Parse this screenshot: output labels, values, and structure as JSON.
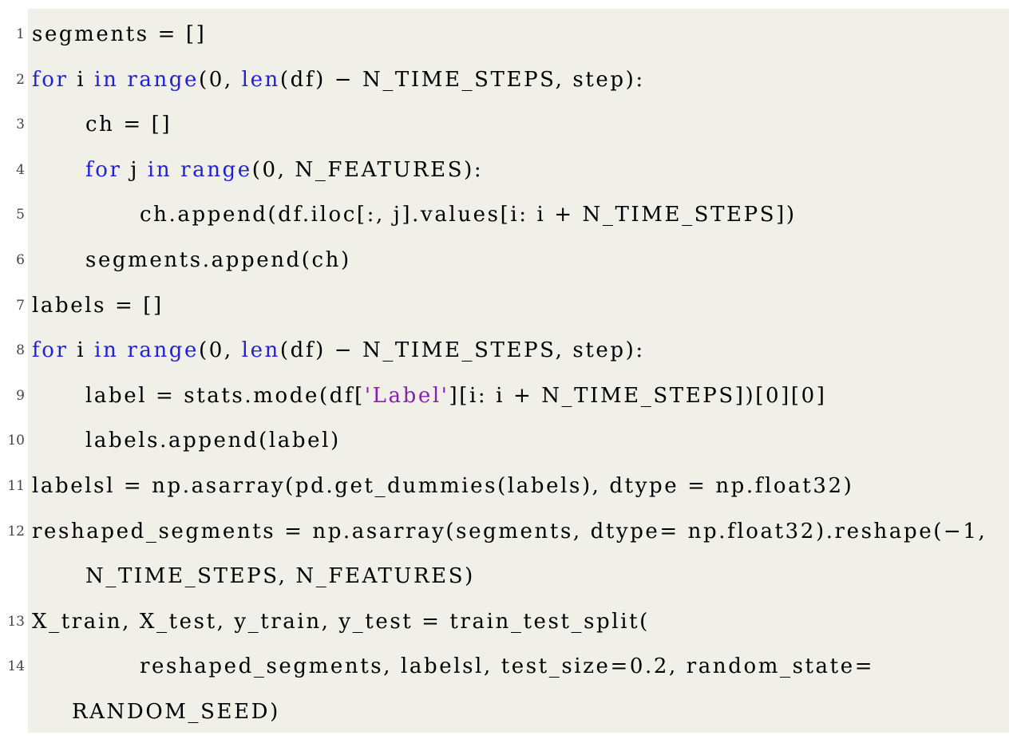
{
  "listing": {
    "background_color": "#f0efe8",
    "keyword_color": "#2020d8",
    "string_color": "#8a1fb0",
    "lines": [
      {
        "number": "1",
        "tokens": [
          {
            "t": "segments = []",
            "k": "plain"
          }
        ]
      },
      {
        "number": "2",
        "tokens": [
          {
            "t": "for",
            "k": "keyword"
          },
          {
            "t": " i ",
            "k": "plain"
          },
          {
            "t": "in",
            "k": "keyword"
          },
          {
            "t": " ",
            "k": "plain"
          },
          {
            "t": "range",
            "k": "builtin"
          },
          {
            "t": "(0, ",
            "k": "plain"
          },
          {
            "t": "len",
            "k": "builtin"
          },
          {
            "t": "(df) − N_TIME_STEPS, step):",
            "k": "plain"
          }
        ]
      },
      {
        "number": "3",
        "indent": 1,
        "tokens": [
          {
            "t": "ch = []",
            "k": "plain"
          }
        ]
      },
      {
        "number": "4",
        "indent": 1,
        "tokens": [
          {
            "t": "for",
            "k": "keyword"
          },
          {
            "t": " j ",
            "k": "plain"
          },
          {
            "t": "in",
            "k": "keyword"
          },
          {
            "t": " ",
            "k": "plain"
          },
          {
            "t": "range",
            "k": "builtin"
          },
          {
            "t": "(0, N_FEATURES):",
            "k": "plain"
          }
        ]
      },
      {
        "number": "5",
        "indent": 2,
        "tokens": [
          {
            "t": "ch.append(df.iloc[:, j].values[i: i + N_TIME_STEPS])",
            "k": "plain"
          }
        ]
      },
      {
        "number": "6",
        "indent": 1,
        "tokens": [
          {
            "t": "segments.append(ch)",
            "k": "plain"
          }
        ]
      },
      {
        "number": "7",
        "tokens": [
          {
            "t": "labels = []",
            "k": "plain"
          }
        ]
      },
      {
        "number": "8",
        "tokens": [
          {
            "t": "for",
            "k": "keyword"
          },
          {
            "t": " i ",
            "k": "plain"
          },
          {
            "t": "in",
            "k": "keyword"
          },
          {
            "t": " ",
            "k": "plain"
          },
          {
            "t": "range",
            "k": "builtin"
          },
          {
            "t": "(0, ",
            "k": "plain"
          },
          {
            "t": "len",
            "k": "builtin"
          },
          {
            "t": "(df) − N_TIME_STEPS, step):",
            "k": "plain"
          }
        ]
      },
      {
        "number": "9",
        "indent": 1,
        "tokens": [
          {
            "t": "label = stats.mode(df[",
            "k": "plain"
          },
          {
            "t": "'Label'",
            "k": "string"
          },
          {
            "t": "][i: i + N_TIME_STEPS])[0][0]",
            "k": "plain"
          }
        ]
      },
      {
        "number": "10",
        "indent": 1,
        "tokens": [
          {
            "t": "labels.append(label)",
            "k": "plain"
          }
        ]
      },
      {
        "number": "11",
        "tokens": [
          {
            "t": "labelsl = np.asarray(pd.get_dummies(labels), dtype = np.float32)",
            "k": "plain"
          }
        ]
      },
      {
        "number": "12",
        "tokens": [
          {
            "t": "reshaped_segments = np.asarray(segments, dtype= np.float32).reshape(−1,",
            "k": "plain"
          }
        ],
        "continuation": "N_TIME_STEPS, N_FEATURES)"
      },
      {
        "number": "13",
        "tokens": [
          {
            "t": "X_train, X_test, y_train, y_test = train_test_split(",
            "k": "plain"
          }
        ]
      },
      {
        "number": "14",
        "indent": 2,
        "tokens": [
          {
            "t": "reshaped_segments, labelsl, test_size=0.2, random_state=",
            "k": "plain"
          }
        ],
        "continuation": "RANDOM_SEED)"
      }
    ]
  }
}
